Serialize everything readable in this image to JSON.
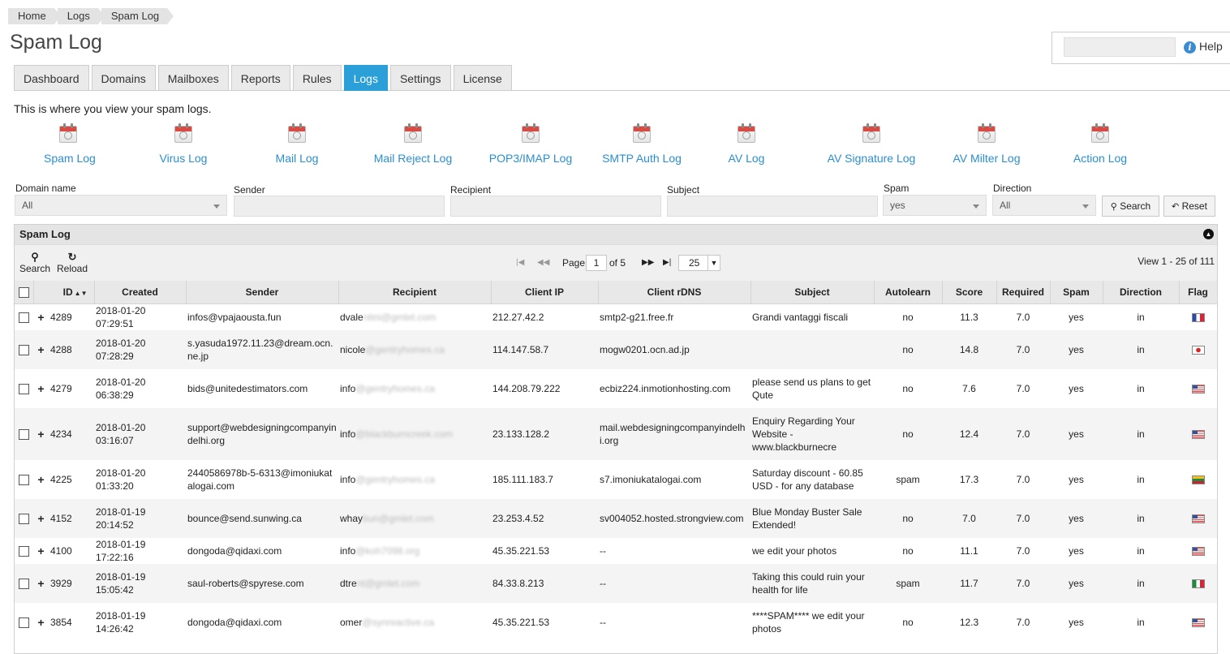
{
  "breadcrumb": [
    "Home",
    "Logs",
    "Spam Log"
  ],
  "title": "Spam Log",
  "help": {
    "label": "Help",
    "search_value": ""
  },
  "tabs": [
    {
      "label": "Dashboard",
      "active": false
    },
    {
      "label": "Domains",
      "active": false
    },
    {
      "label": "Mailboxes",
      "active": false
    },
    {
      "label": "Reports",
      "active": false
    },
    {
      "label": "Rules",
      "active": false
    },
    {
      "label": "Logs",
      "active": true
    },
    {
      "label": "Settings",
      "active": false
    },
    {
      "label": "License",
      "active": false
    }
  ],
  "description": "This is where you view your spam logs.",
  "log_types": [
    {
      "label": "Spam Log",
      "icon": "spam-log-icon"
    },
    {
      "label": "Virus Log",
      "icon": "virus-log-icon"
    },
    {
      "label": "Mail Log",
      "icon": "mail-log-icon"
    },
    {
      "label": "Mail Reject Log",
      "icon": "mail-reject-log-icon"
    },
    {
      "label": "POP3/IMAP Log",
      "icon": "pop3-imap-log-icon"
    },
    {
      "label": "SMTP Auth Log",
      "icon": "smtp-auth-log-icon"
    },
    {
      "label": "AV Log",
      "icon": "av-log-icon"
    },
    {
      "label": "AV Signature Log",
      "icon": "av-signature-log-icon"
    },
    {
      "label": "AV Milter Log",
      "icon": "av-milter-log-icon"
    },
    {
      "label": "Action Log",
      "icon": "action-log-icon"
    }
  ],
  "filters": {
    "domain_label": "Domain name",
    "domain_value": "All",
    "sender_label": "Sender",
    "sender_value": "",
    "recipient_label": "Recipient",
    "recipient_value": "",
    "subject_label": "Subject",
    "subject_value": "",
    "spam_label": "Spam",
    "spam_value": "yes",
    "direction_label": "Direction",
    "direction_value": "All",
    "search_button": "Search",
    "reset_button": "Reset"
  },
  "grid": {
    "title": "Spam Log",
    "toolbar_search": "Search",
    "toolbar_reload": "Reload",
    "pager": {
      "page_label": "Page",
      "page": "1",
      "of_label": "of 5",
      "page_size": "25"
    },
    "view_info": "View 1 - 25 of 111",
    "columns": [
      "ID",
      "Created",
      "Sender",
      "Recipient",
      "Client IP",
      "Client rDNS",
      "Subject",
      "Autolearn",
      "Score",
      "Required",
      "Spam",
      "Direction",
      "Flag"
    ],
    "rows": [
      {
        "id": "4289",
        "created": "2018-01-20 07:29:51",
        "sender": "infos@vpajaousta.fun",
        "recipient_user": "dvale",
        "recipient_rest": "ntini@gmlet.com",
        "client_ip": "212.27.42.2",
        "rdns": "smtp2-g21.free.fr",
        "subject": "Grandi vantaggi fiscali",
        "autolearn": "no",
        "score": "11.3",
        "required": "7.0",
        "spam": "yes",
        "direction": "in",
        "flag": "FR"
      },
      {
        "id": "4288",
        "created": "2018-01-20 07:28:29",
        "sender": "s.yasuda1972.11.23@dream.ocn.ne.jp",
        "recipient_user": "nicole",
        "recipient_rest": "@gentryhomes.ca",
        "client_ip": "114.147.58.7",
        "rdns": "mogw0201.ocn.ad.jp",
        "subject": "",
        "autolearn": "no",
        "score": "14.8",
        "required": "7.0",
        "spam": "yes",
        "direction": "in",
        "flag": "JP"
      },
      {
        "id": "4279",
        "created": "2018-01-20 06:38:29",
        "sender": "bids@unitedestimators.com",
        "recipient_user": "info",
        "recipient_rest": "@gentryhomes.ca",
        "client_ip": "144.208.79.222",
        "rdns": "ecbiz224.inmotionhosting.com",
        "subject": "please send us plans to get Qute",
        "autolearn": "no",
        "score": "7.6",
        "required": "7.0",
        "spam": "yes",
        "direction": "in",
        "flag": "US"
      },
      {
        "id": "4234",
        "created": "2018-01-20 03:16:07",
        "sender": "support@webdesigningcompanyindelhi.org",
        "recipient_user": "info",
        "recipient_rest": "@blackburncreek.com",
        "client_ip": "23.133.128.2",
        "rdns": "mail.webdesigningcompanyindelhi.org",
        "subject": "Enquiry Regarding Your Website - www.blackburnecre",
        "autolearn": "no",
        "score": "12.4",
        "required": "7.0",
        "spam": "yes",
        "direction": "in",
        "flag": "US"
      },
      {
        "id": "4225",
        "created": "2018-01-20 01:33:20",
        "sender": "2440586978b-5-6313@imoniukatalogai.com",
        "recipient_user": "info",
        "recipient_rest": "@gentryhomes.ca",
        "client_ip": "185.111.183.7",
        "rdns": "s7.imoniukatalogai.com",
        "subject": "Saturday discount - 60.85 USD - for any database",
        "autolearn": "spam",
        "score": "17.3",
        "required": "7.0",
        "spam": "yes",
        "direction": "in",
        "flag": "LT"
      },
      {
        "id": "4152",
        "created": "2018-01-19 20:14:52",
        "sender": "bounce@send.sunwing.ca",
        "recipient_user": "whay",
        "recipient_rest": "bun@gmlet.com",
        "client_ip": "23.253.4.52",
        "rdns": "sv004052.hosted.strongview.com",
        "subject": "Blue Monday Buster Sale Extended!",
        "autolearn": "no",
        "score": "7.0",
        "required": "7.0",
        "spam": "yes",
        "direction": "in",
        "flag": "US"
      },
      {
        "id": "4100",
        "created": "2018-01-19 17:22:16",
        "sender": "dongoda@qidaxi.com",
        "recipient_user": "info",
        "recipient_rest": "@koh7098.org",
        "client_ip": "45.35.221.53",
        "rdns": "--",
        "subject": "we edit your photos",
        "autolearn": "no",
        "score": "11.1",
        "required": "7.0",
        "spam": "yes",
        "direction": "in",
        "flag": "US"
      },
      {
        "id": "3929",
        "created": "2018-01-19 15:05:42",
        "sender": "saul-roberts@spyrese.com",
        "recipient_user": "dtre",
        "recipient_rest": "nt@gmlet.com",
        "client_ip": "84.33.8.213",
        "rdns": "--",
        "subject": "Taking this could ruin your health for life",
        "autolearn": "spam",
        "score": "11.7",
        "required": "7.0",
        "spam": "yes",
        "direction": "in",
        "flag": "IT"
      },
      {
        "id": "3854",
        "created": "2018-01-19 14:26:42",
        "sender": "dongoda@qidaxi.com",
        "recipient_user": "omer",
        "recipient_rest": "@synreactive.ca",
        "client_ip": "45.35.221.53",
        "rdns": "--",
        "subject": "****SPAM**** we edit your photos",
        "autolearn": "no",
        "score": "12.3",
        "required": "7.0",
        "spam": "yes",
        "direction": "in",
        "flag": "US"
      }
    ]
  }
}
